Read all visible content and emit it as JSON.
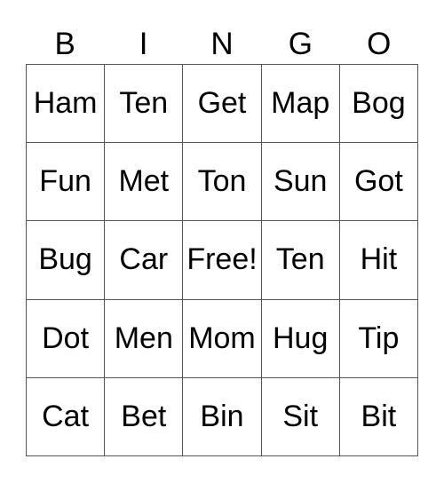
{
  "header": [
    "B",
    "I",
    "N",
    "G",
    "O"
  ],
  "cells": [
    [
      "Ham",
      "Ten",
      "Get",
      "Map",
      "Bog"
    ],
    [
      "Fun",
      "Met",
      "Ton",
      "Sun",
      "Got"
    ],
    [
      "Bug",
      "Car",
      "Free!",
      "Ten",
      "Hit"
    ],
    [
      "Dot",
      "Men",
      "Mom",
      "Hug",
      "Tip"
    ],
    [
      "Cat",
      "Bet",
      "Bin",
      "Sit",
      "Bit"
    ]
  ]
}
